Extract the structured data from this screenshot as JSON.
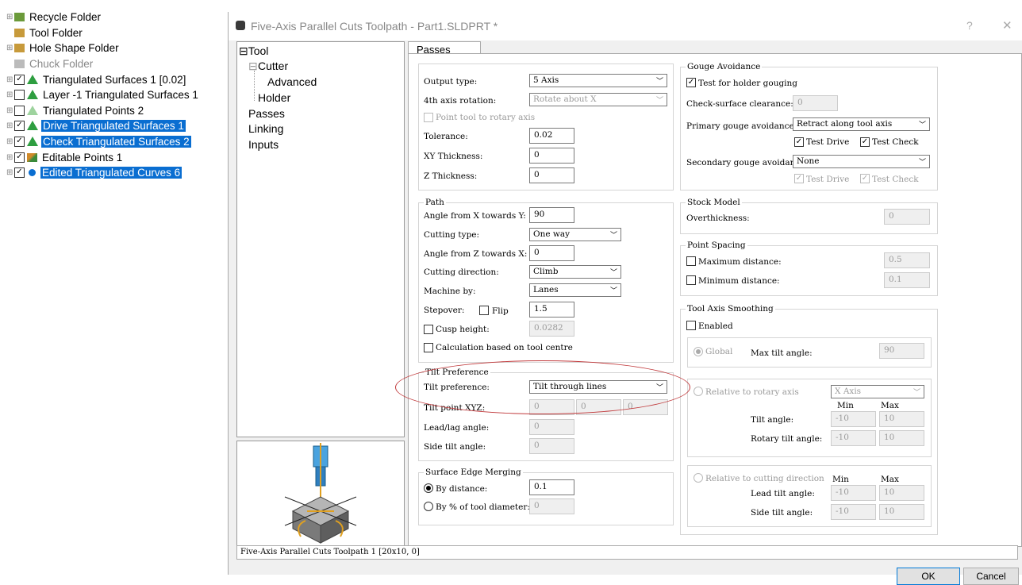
{
  "tree": {
    "items": [
      {
        "label": "Recycle Folder",
        "check": "",
        "selected": false
      },
      {
        "label": "Tool Folder",
        "check": "",
        "selected": false
      },
      {
        "label": "Hole Shape Folder",
        "check": "",
        "selected": false
      },
      {
        "label": "Chuck Folder",
        "check": "",
        "selected": false
      },
      {
        "label": "Triangulated Surfaces 1 [0.02]",
        "check": "☑",
        "selected": false
      },
      {
        "label": "Layer -1 Triangulated Surfaces 1",
        "check": "☐",
        "selected": false
      },
      {
        "label": "Triangulated Points 2",
        "check": "☐",
        "selected": false
      },
      {
        "label": "Drive Triangulated Surfaces 1",
        "check": "☑",
        "selected": true
      },
      {
        "label": "Check Triangulated Surfaces 2",
        "check": "☑",
        "selected": true
      },
      {
        "label": "Editable Points 1",
        "check": "☑",
        "selected": false
      },
      {
        "label": "Edited Triangulated Curves 6",
        "check": "☑",
        "selected": true
      }
    ]
  },
  "dialog": {
    "title": "Five-Axis Parallel Cuts Toolpath - Part1.SLDPRT *",
    "help": "?",
    "close": "✕",
    "nav": {
      "tool": "Tool",
      "cutter": "Cutter",
      "advanced": "Advanced",
      "holder": "Holder",
      "passes": "Passes",
      "linking": "Linking",
      "inputs": "Inputs"
    },
    "tab": "Passes",
    "status": "Five-Axis Parallel Cuts Toolpath 1 [20x10, 0]",
    "ok": "OK",
    "cancel": "Cancel"
  },
  "passes": {
    "output_type_label": "Output type:",
    "output_type": "5 Axis",
    "fourth_axis_label": "4th axis rotation:",
    "fourth_axis": "Rotate  about X",
    "point_rotary_label": "Point tool to rotary axis",
    "tolerance_label": "Tolerance:",
    "tolerance": "0.02",
    "xy_thickness_label": "XY Thickness:",
    "xy_thickness": "0",
    "z_thickness_label": "Z Thickness:",
    "z_thickness": "0"
  },
  "path": {
    "title": "Path",
    "angle_xy_label": "Angle from X towards Y:",
    "angle_xy": "90",
    "cutting_type_label": "Cutting type:",
    "cutting_type": "One way",
    "angle_zx_label": "Angle from Z towards X:",
    "angle_zx": "0",
    "cutting_dir_label": "Cutting direction:",
    "cutting_dir": "Climb",
    "machine_by_label": "Machine by:",
    "machine_by": "Lanes",
    "stepover_label": "Stepover:",
    "flip_label": "Flip",
    "stepover": "1.5",
    "cusp_label": "Cusp height:",
    "cusp": "0.0282",
    "calc_label": "Calculation based on tool centre"
  },
  "tilt": {
    "title": "Tilt Preference",
    "pref_label": "Tilt preference:",
    "pref": "Tilt through lines",
    "point_label": "Tilt point XYZ:",
    "px": "0",
    "py": "0",
    "pz": "0",
    "lead_label": "Lead/lag angle:",
    "lead": "0",
    "side_label": "Side tilt angle:",
    "side": "0"
  },
  "edge": {
    "title": "Surface Edge Merging",
    "by_distance_label": "By distance:",
    "by_distance": "0.1",
    "by_pct_label": "By % of tool diameter:",
    "by_pct": "0"
  },
  "gouge": {
    "title": "Gouge Avoidance",
    "holder_label": "Test for holder gouging",
    "check_clear_label": "Check-surface clearance:",
    "check_clear": "0",
    "primary_label": "Primary gouge avoidance:",
    "primary": "Retract along tool axis",
    "test_drive": "Test Drive",
    "test_check": "Test Check",
    "secondary_label": "Secondary gouge avoidance:",
    "secondary": "None"
  },
  "stock": {
    "title": "Stock Model",
    "over_label": "Overthickness:",
    "over": "0"
  },
  "spacing": {
    "title": "Point Spacing",
    "max_label": "Maximum distance:",
    "max": "0.5",
    "min_label": "Minimum distance:",
    "min": "0.1"
  },
  "smoothing": {
    "title": "Tool Axis Smoothing",
    "enabled_label": "Enabled",
    "global_label": "Global",
    "max_tilt_label": "Max tilt angle:",
    "max_tilt": "90",
    "rotary_label": "Relative to rotary axis",
    "rotary_axis": "X Axis",
    "min_h": "Min",
    "max_h": "Max",
    "tilt_label": "Tilt angle:",
    "tilt_min": "-10",
    "tilt_max": "10",
    "rot_tilt_label": "Rotary tilt angle:",
    "rot_min": "-10",
    "rot_max": "10",
    "cutdir_label": "Relative to cutting direction",
    "lead_label": "Lead tilt angle:",
    "lead_min": "-10",
    "lead_max": "10",
    "side_label": "Side tilt angle:",
    "side_min": "-10",
    "side_max": "10"
  }
}
